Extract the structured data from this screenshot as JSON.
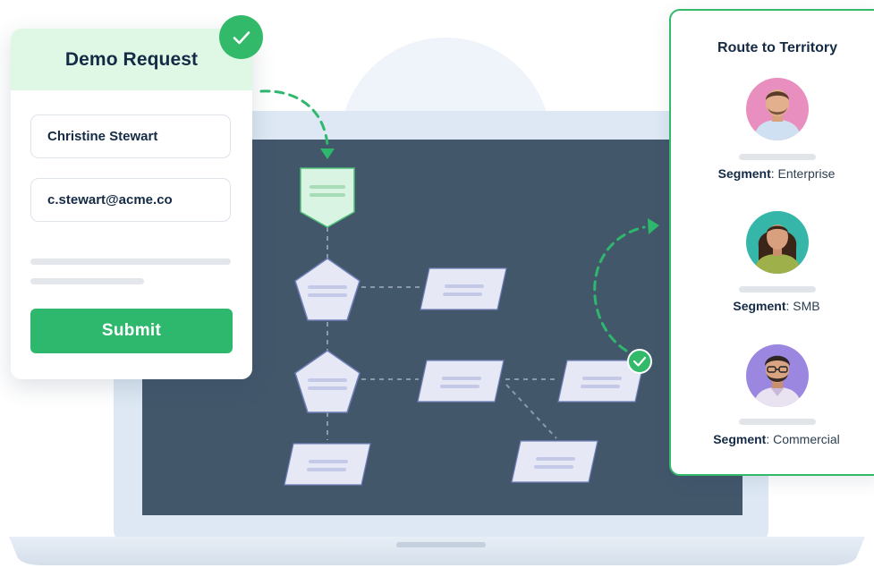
{
  "form": {
    "title": "Demo Request",
    "name_value": "Christine Stewart",
    "email_value": "c.stewart@acme.co",
    "submit_label": "Submit",
    "status_icon": "check-icon"
  },
  "routing": {
    "title": "Route to Territory",
    "segment_label": "Segment",
    "reps": [
      {
        "segment": "Enterprise",
        "avatar_bg": "#e98fc0",
        "shirt": "#cfe0f3"
      },
      {
        "segment": "SMB",
        "avatar_bg": "#35b6a9",
        "shirt": "#9db04a"
      },
      {
        "segment": "Commercial",
        "avatar_bg": "#9b86e0",
        "shirt": "#e9e2f0"
      }
    ]
  },
  "colors": {
    "accent": "#2eb86d",
    "screen": "#43576b",
    "node_fill": "#e6e8f6",
    "start_node": "#d9f4e2"
  }
}
